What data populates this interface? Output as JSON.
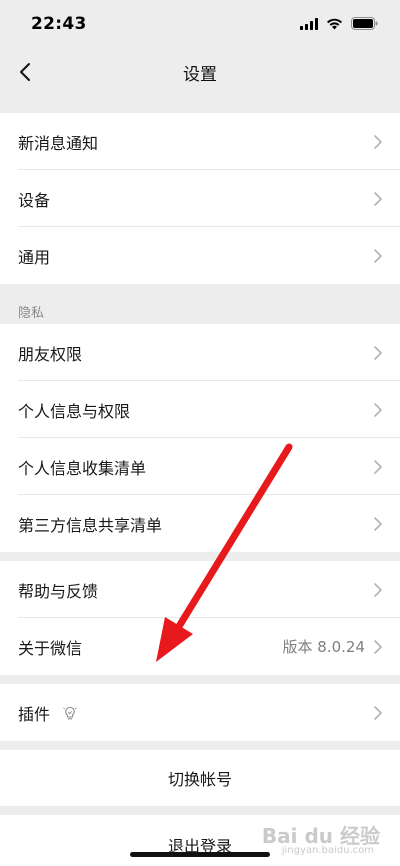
{
  "status": {
    "time": "22:43"
  },
  "nav": {
    "title": "设置"
  },
  "group1": [
    {
      "label": "新消息通知"
    },
    {
      "label": "设备"
    },
    {
      "label": "通用"
    }
  ],
  "privacy": {
    "section_label": "隐私",
    "items": [
      {
        "label": "朋友权限"
      },
      {
        "label": "个人信息与权限"
      },
      {
        "label": "个人信息收集清单"
      },
      {
        "label": "第三方信息共享清单"
      }
    ]
  },
  "group3": {
    "help": "帮助与反馈",
    "about": "关于微信",
    "version": "版本 8.0.24"
  },
  "plugins": {
    "label": "插件"
  },
  "switch_account": "切换帐号",
  "logout": "退出登录",
  "watermark": {
    "brand": "Bai du 经验",
    "sub": "jingyan.baidu.com"
  },
  "colors": {
    "arrow": "#e8191c",
    "background": "#ededed"
  }
}
